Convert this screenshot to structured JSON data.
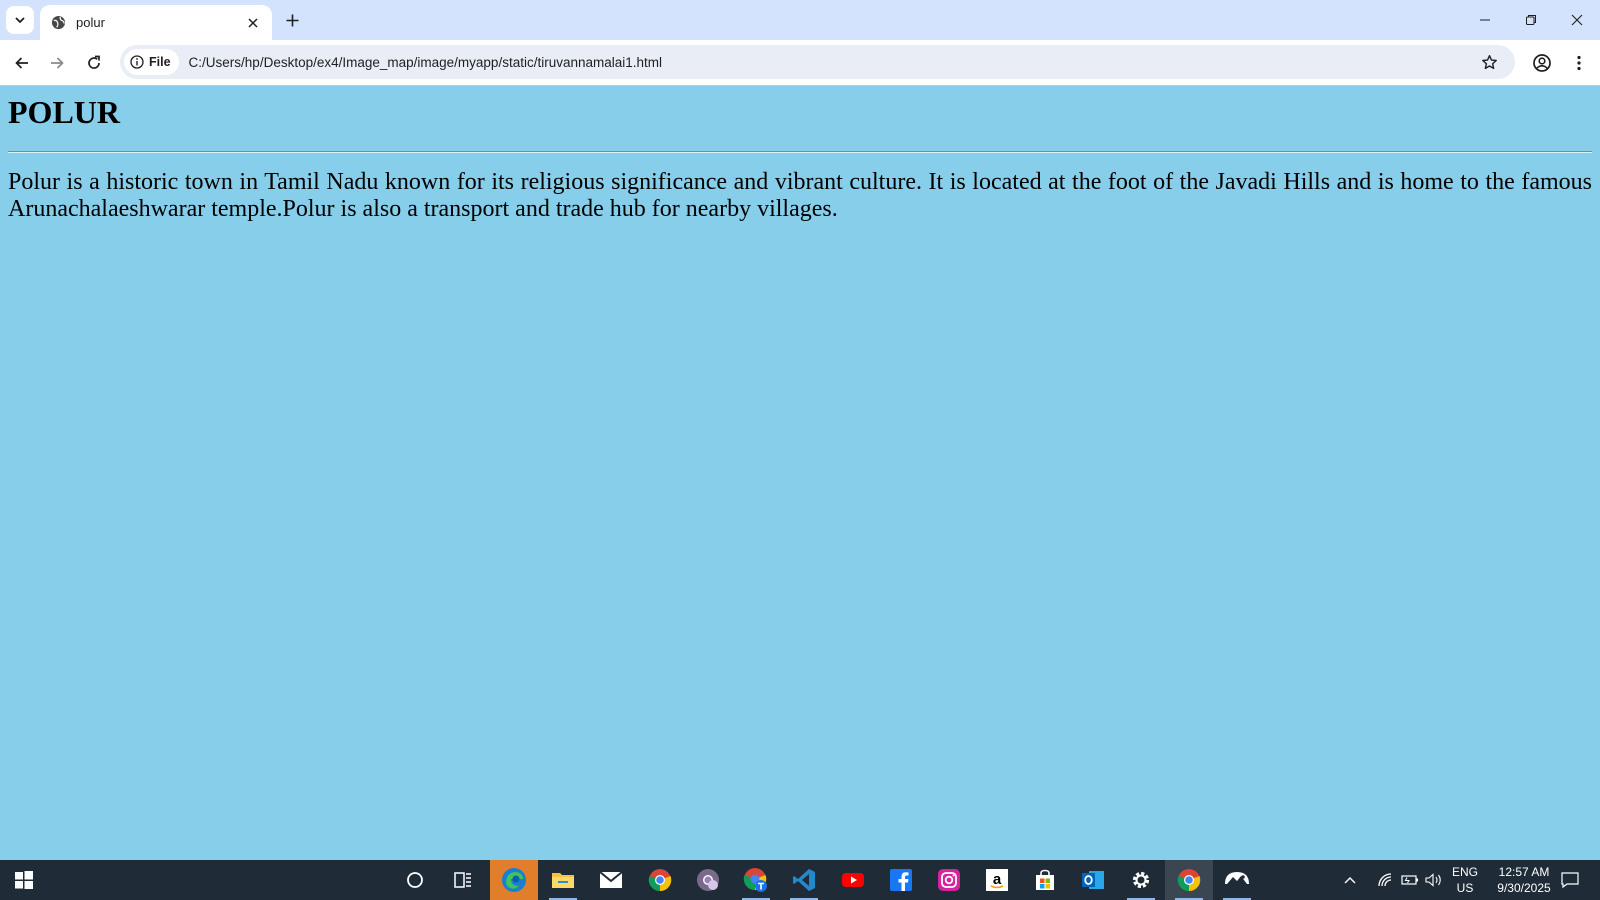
{
  "browser": {
    "tab_title": "polur",
    "site_chip_label": "File",
    "url": "C:/Users/hp/Desktop/ex4/Image_map/image/myapp/static/tiruvannamalai1.html"
  },
  "page": {
    "heading": "POLUR",
    "paragraph": "Polur is a historic town in Tamil Nadu known for its religious significance and vibrant culture. It is located at the foot of the Javadi Hills and is home to the famous Arunachalaeshwarar temple.Polur is also a transport and trade hub for nearby villages.",
    "background_color": "#87ceeb"
  },
  "taskbar": {
    "apps": [
      "start-icon",
      "search-icon",
      "task-view-icon",
      "edge-icon",
      "file-explorer-icon",
      "mail-icon",
      "chrome-icon",
      "chrome-profile-icon",
      "chrome-profile-t-icon",
      "vscode-icon",
      "youtube-icon",
      "facebook-icon",
      "instagram-icon",
      "amazon-icon",
      "store-icon",
      "outlook-icon",
      "settings-icon",
      "chrome-active-icon",
      "photos-icon"
    ],
    "language": "ENG",
    "region": "US",
    "time": "12:57 AM",
    "date": "9/30/2025"
  }
}
